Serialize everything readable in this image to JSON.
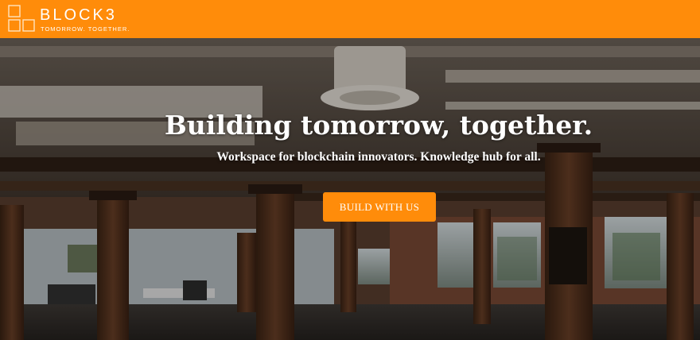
{
  "header": {
    "brand": "BLOCK3",
    "tagline": "TOMORROW. TOGETHER.",
    "background_color": "#ff8c0a"
  },
  "hero": {
    "title": "Building tomorrow, together.",
    "subtitle": "Workspace for blockchain innovators. Knowledge hub for all.",
    "cta_label": "BUILD WITH US",
    "cta_color": "#ff8c0a",
    "background_image": "office-interior-photo"
  },
  "icons": {
    "logo": "squares-grid-logo-icon"
  }
}
